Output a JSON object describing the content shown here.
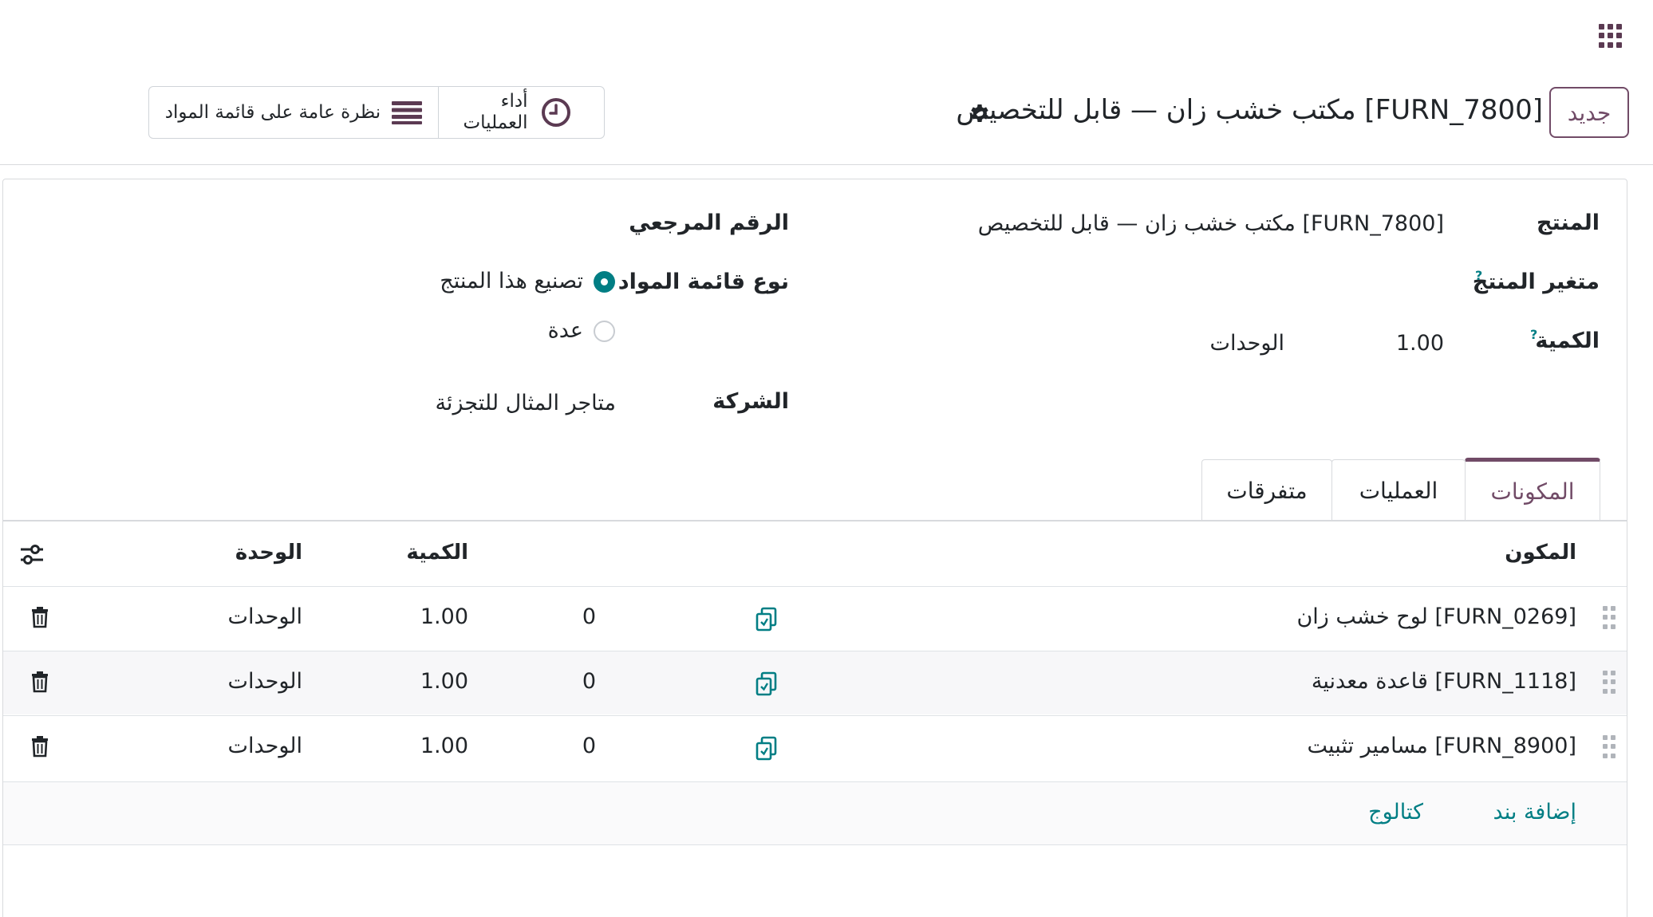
{
  "topbar": {
    "apps_icon": "apps-grid-icon"
  },
  "control_panel": {
    "new_button": "جديد",
    "record_title": "[FURN_7800] مكتب خشب زان — قابل للتخصيص",
    "gear_icon": "gear-icon",
    "smart_buttons": {
      "operations_performance": "أداء العمليات",
      "bom_overview": "نظرة عامة على قائمة المواد"
    }
  },
  "form": {
    "product_label": "المنتج",
    "product_value": "[FURN_7800] مكتب خشب زان — قابل للتخصيص",
    "variant_label": "متغير المنتج",
    "quantity_label": "الكمية",
    "quantity_value": "1.00",
    "quantity_uom": "الوحدات",
    "help_mark": "?",
    "reference_label": "الرقم المرجعي",
    "bom_type_label": "نوع قائمة المواد",
    "bom_type_options": [
      {
        "label": "تصنيع هذا المنتج",
        "selected": true
      },
      {
        "label": "عدة",
        "selected": false
      }
    ],
    "company_label": "الشركة",
    "company_value": "متاجر المثال للتجزئة"
  },
  "tabs": [
    {
      "label": "المكونات",
      "active": true
    },
    {
      "label": "العمليات",
      "active": false
    },
    {
      "label": "متفرقات",
      "active": false
    }
  ],
  "components_table": {
    "headers": {
      "component": "المكون",
      "quantity": "الكمية",
      "unit": "الوحدة"
    },
    "rows": [
      {
        "component": "[FURN_0269] لوح خشب زان",
        "copies": "0",
        "quantity": "1.00",
        "unit": "الوحدات"
      },
      {
        "component": "[FURN_1118] قاعدة معدنية",
        "copies": "0",
        "quantity": "1.00",
        "unit": "الوحدات"
      },
      {
        "component": "[FURN_8900] مسامير تثبيت",
        "copies": "0",
        "quantity": "1.00",
        "unit": "الوحدات"
      }
    ],
    "add_line": "إضافة بند",
    "catalog": "كتالوج"
  },
  "colors": {
    "brand": "#714b67",
    "accent": "#017e84"
  }
}
